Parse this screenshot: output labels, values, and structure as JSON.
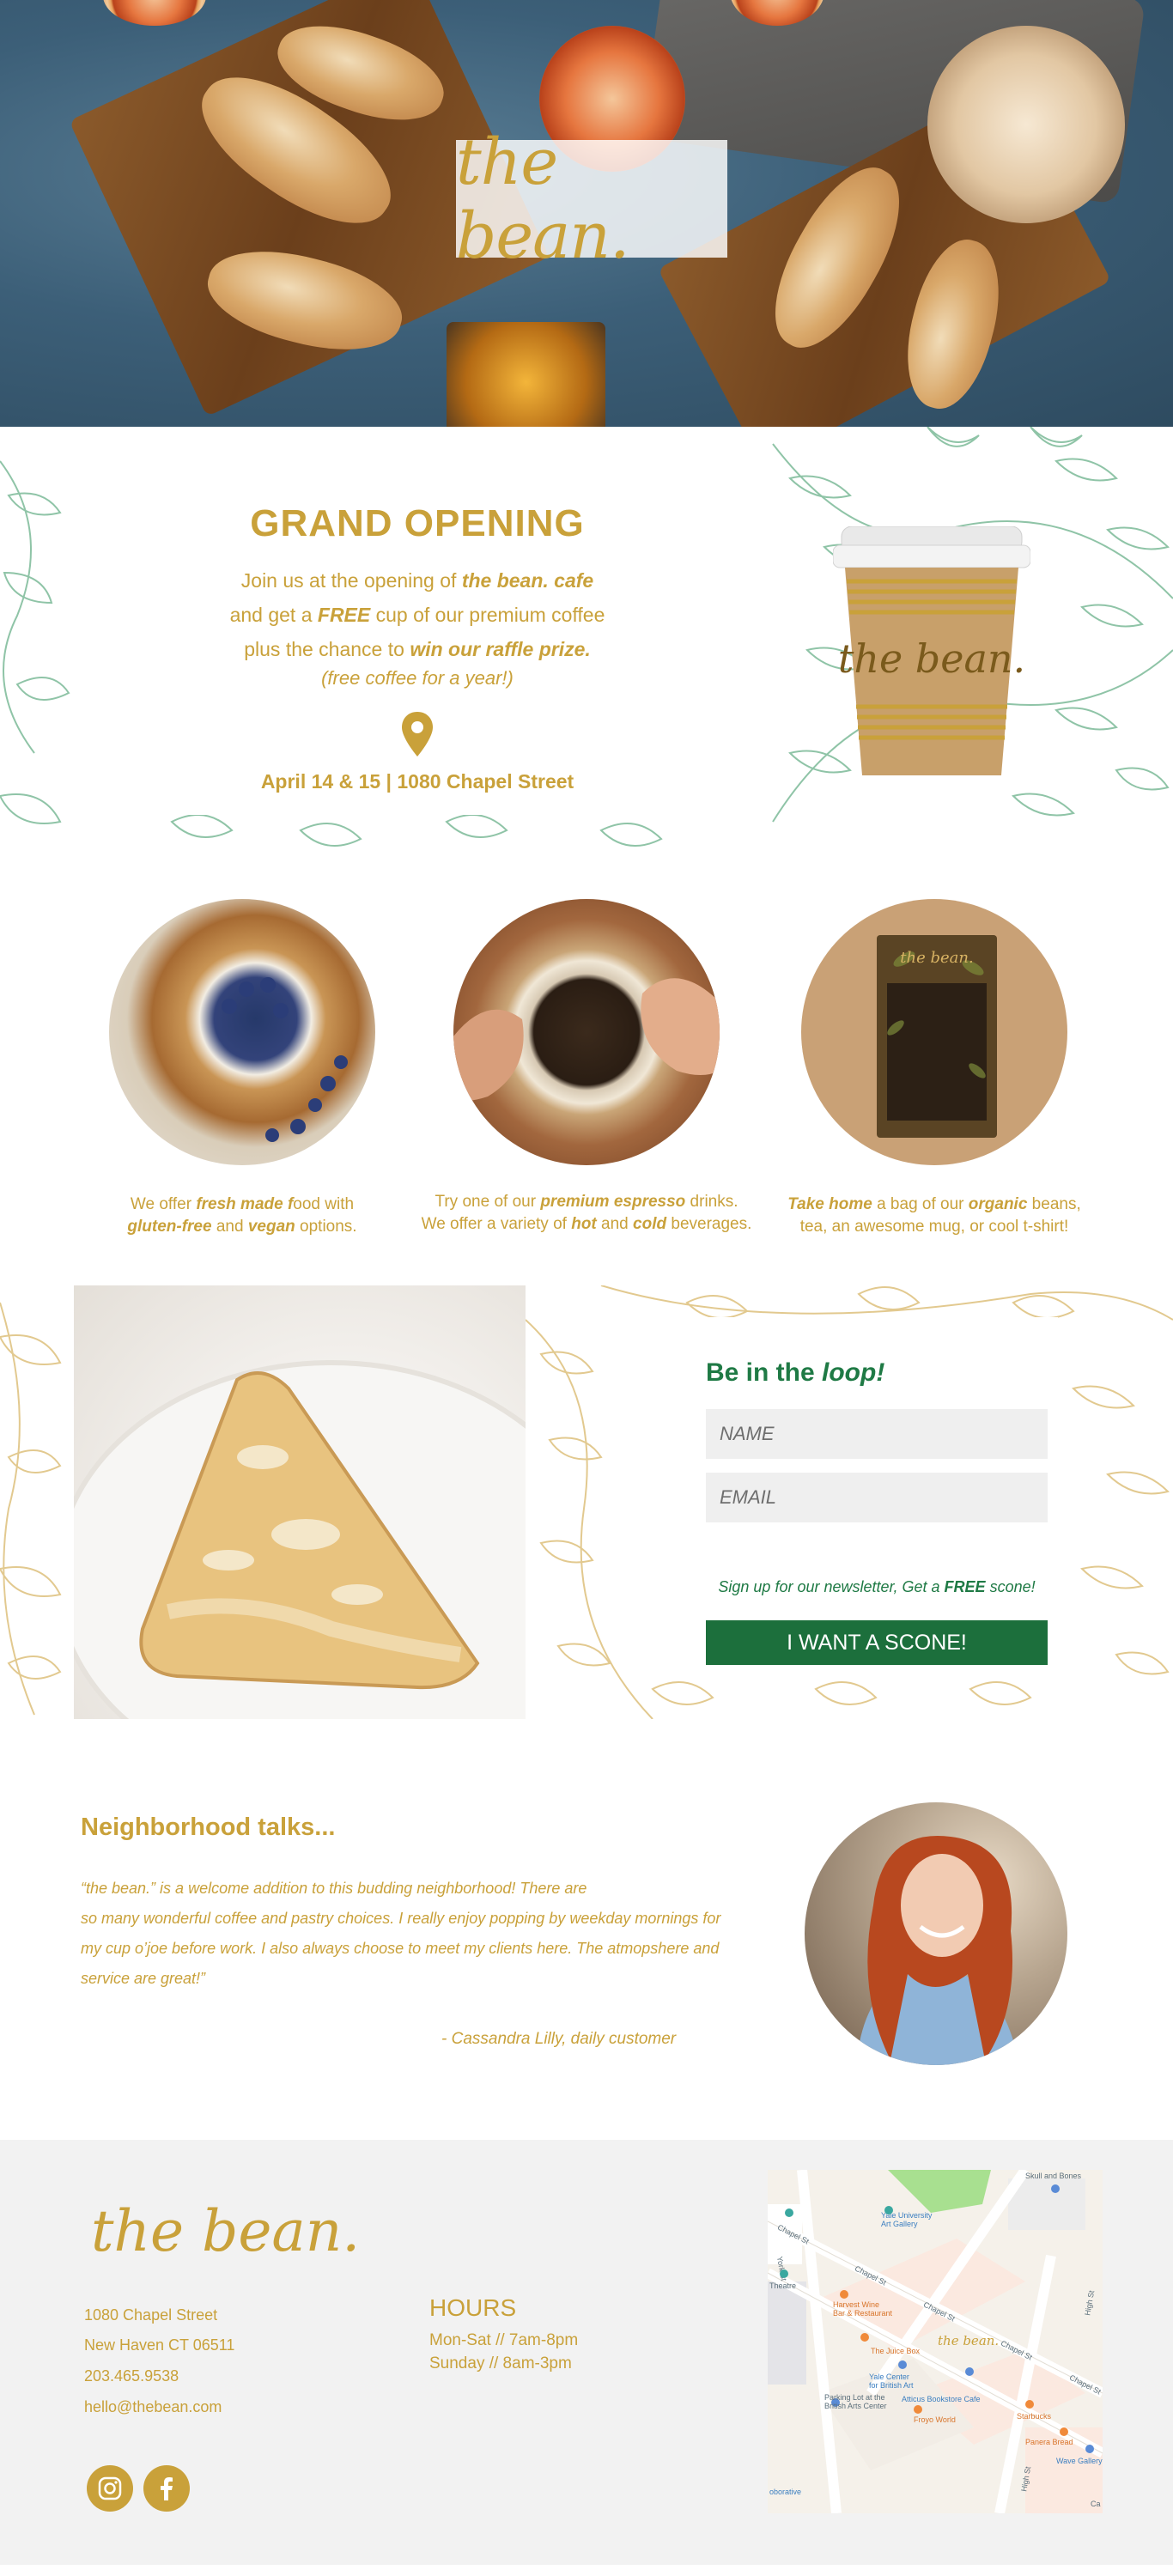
{
  "brand": {
    "logo_text": "the bean.",
    "colors": {
      "gold": "#c9a13a",
      "green": "#1f7a45",
      "button": "#1c6f3c",
      "footer_bg": "#f2f2f2"
    }
  },
  "opening": {
    "title": "GRAND OPENING",
    "line1_prefix": "Join us at the opening of ",
    "line1_em": "the bean. cafe",
    "line2_prefix": "and get a ",
    "line2_em": "FREE",
    "line2_suffix": " cup of our premium coffee",
    "line3_prefix": "plus the chance to ",
    "line3_em": "win our raffle prize.",
    "line4": "(free coffee for a year!)",
    "pin_icon": "location-pin-icon",
    "date": "April 14 & 15 | 1080 Chapel Street",
    "cup_logo": "the bean."
  },
  "features": [
    {
      "p1": "We offer ",
      "e1": "fresh made f",
      "p2": "ood with",
      "e2": "gluten-free",
      "p3": " and ",
      "e3": "vegan",
      "p4": " options."
    },
    {
      "p1": "Try one of our ",
      "e1": "premium espresso",
      "p2": " drinks.",
      "p3": "We offer a variety of ",
      "e2": "hot",
      "p4": " and ",
      "e3": "cold",
      "p5": "  beverages."
    },
    {
      "e1": "Take home",
      "p1": " a bag of our ",
      "e2": "organic",
      "p2": " beans,",
      "p3": "tea, an awesome mug, or cool t-shirt!"
    }
  ],
  "newsletter": {
    "title_prefix": "Be in the ",
    "title_em": "loop!",
    "name_placeholder": "NAME",
    "email_placeholder": "EMAIL",
    "note_prefix": "Sign up for our newsletter, Get a ",
    "note_em": "FREE",
    "note_suffix": " scone!",
    "button": "I WANT A SCONE!"
  },
  "testimonial": {
    "title": "Neighborhood talks...",
    "quote_lines": [
      "“the bean.” is a welcome addition to this budding neighborhood! There are",
      "so many wonderful coffee and pastry choices. I really enjoy popping by weekday mornings for",
      "my cup o’joe before work. I also always choose to meet my clients here. The atmopshere and",
      "service are great!”"
    ],
    "author": "- Cassandra Lilly, daily customer"
  },
  "footer": {
    "logo_text": "the bean.",
    "address": "1080 Chapel Street",
    "city": "New Haven CT 06511",
    "phone": "203.465.9538",
    "email": "hello@thebean.com",
    "hours_title": "HOURS",
    "hours_weekday": "Mon-Sat //  7am-8pm",
    "hours_sunday": "Sunday // 8am-3pm",
    "instagram_icon": "instagram-icon",
    "facebook_icon": "facebook-icon"
  },
  "map": {
    "labels": {
      "skull": "Skull and Bones",
      "yale_gallery": "Yale University\nArt Gallery",
      "chapel1": "Chapel St",
      "chapel2": "Chapel St",
      "chapel3": "Chapel St",
      "chapel4": "Chapel St",
      "chapel5": "Chapel St",
      "harvest": "Harvest Wine\nBar & Restaurant",
      "juice": "The Juice Box",
      "yale_center": "Yale Center\nfor British Art",
      "parking": "Parking Lot at the\nBritish Arts Center",
      "atticus": "Atticus Bookstore Cafe",
      "froyo": "Froyo World",
      "starbucks": "Starbucks",
      "panera": "Panera Bread",
      "wave": "Wave Gallery",
      "york": "York St",
      "high1": "High St",
      "high2": "High St",
      "theatre": "Theatre",
      "oborative": "oborative",
      "ca": "Ca",
      "pin_logo": "the bean."
    }
  }
}
